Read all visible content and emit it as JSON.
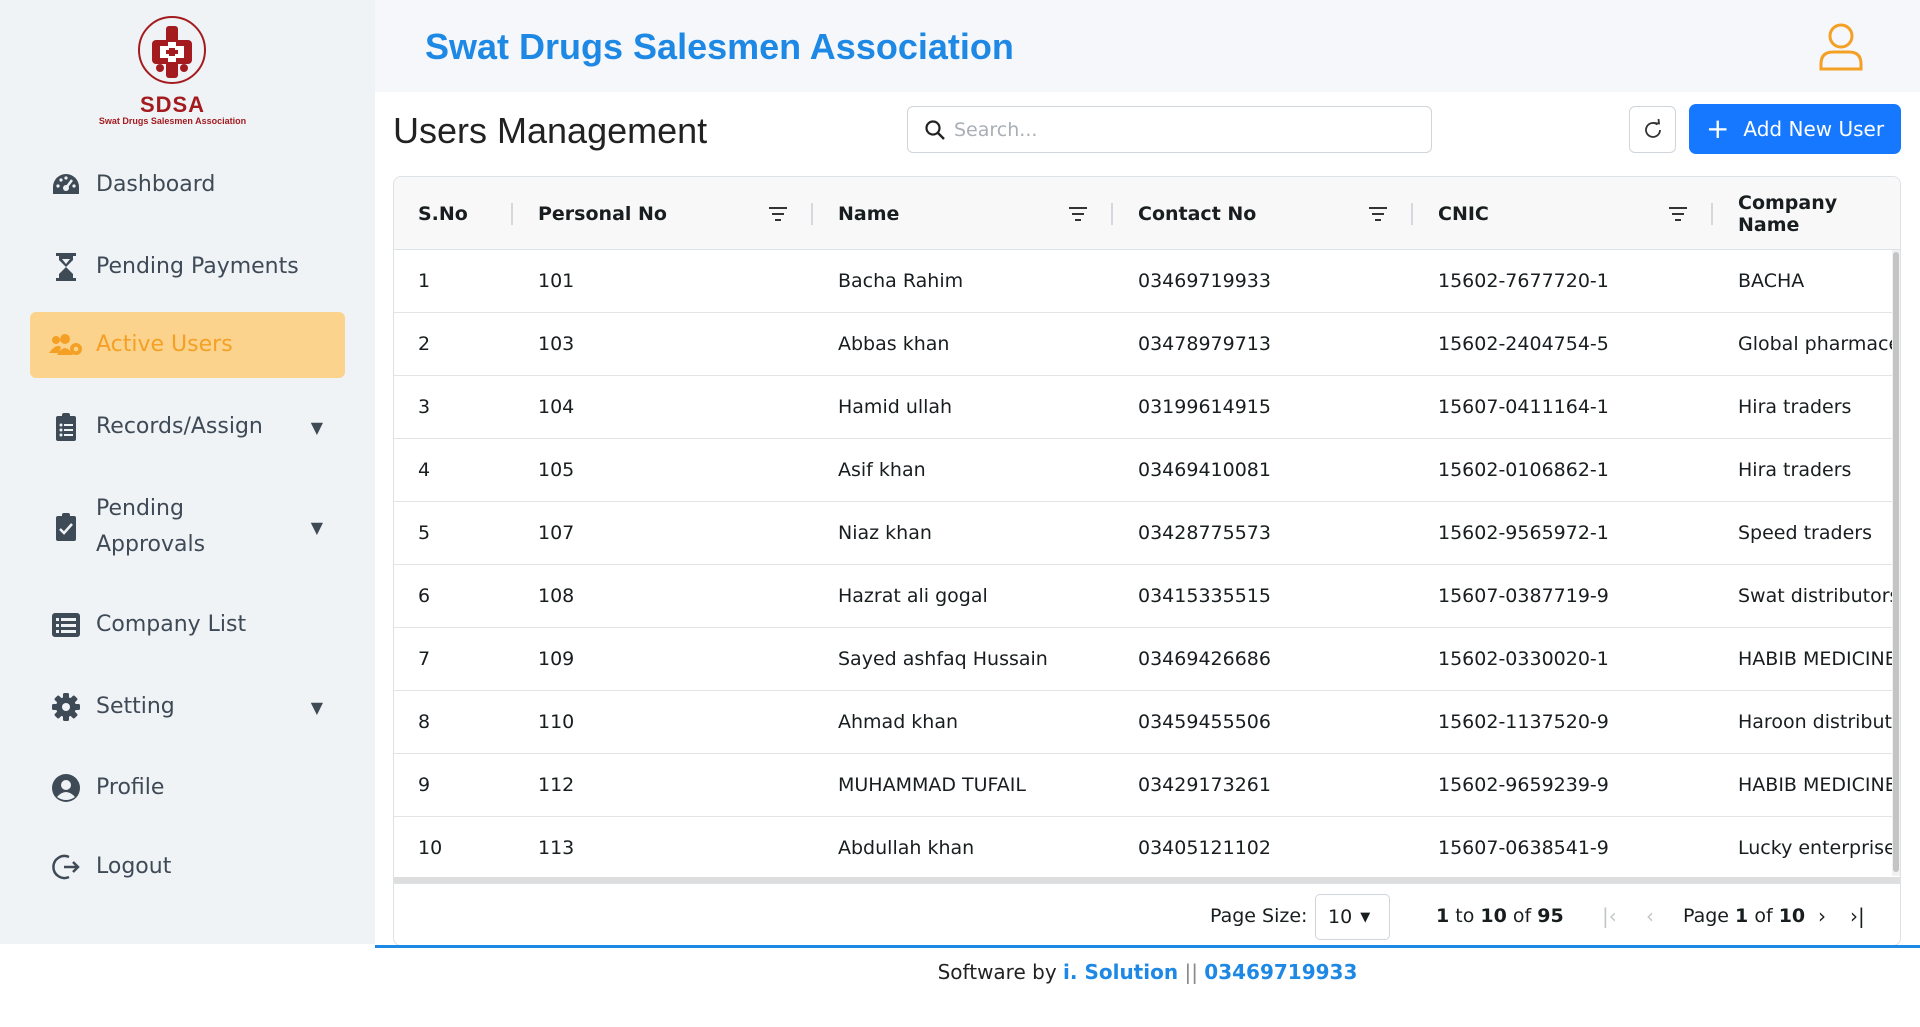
{
  "app": {
    "title": "Swat Drugs Salesmen Association",
    "logo_short": "SDSA",
    "logo_full": "Swat Drugs Salesmen Association"
  },
  "sidebar": {
    "items": [
      {
        "label": "Dashboard",
        "icon": "dashboard-gauge-icon"
      },
      {
        "label": "Pending Payments",
        "icon": "hourglass-icon"
      },
      {
        "label": "Active Users",
        "icon": "users-gear-icon",
        "active": true
      },
      {
        "label": "Records/Assign",
        "icon": "clipboard-list-icon",
        "caret": "▼"
      },
      {
        "label": "Pending",
        "label2": "Approvals",
        "icon": "clipboard-check-icon",
        "caret": "▼"
      },
      {
        "label": "Company List",
        "icon": "list-icon"
      },
      {
        "label": "Setting",
        "icon": "gear-icon",
        "caret": "▼"
      },
      {
        "label": "Profile",
        "icon": "user-circle-icon"
      },
      {
        "label": "Logout",
        "icon": "logout-icon"
      }
    ]
  },
  "main": {
    "title": "Users Management",
    "search_placeholder": "Search...",
    "add_button": "Add New User",
    "add_plus": "+"
  },
  "table": {
    "columns": [
      "S.No",
      "Personal No",
      "Name",
      "Contact No",
      "CNIC",
      "Company Name"
    ],
    "rows": [
      [
        "1",
        "101",
        "Bacha Rahim",
        "03469719933",
        "15602-7677720-1",
        "BACHA"
      ],
      [
        "2",
        "103",
        "Abbas khan",
        "03478979713",
        "15602-2404754-5",
        "Global pharmaceuticals"
      ],
      [
        "3",
        "104",
        "Hamid ullah",
        "03199614915",
        "15607-0411164-1",
        "Hira traders"
      ],
      [
        "4",
        "105",
        "Asif khan",
        "03469410081",
        "15602-0106862-1",
        "Hira traders"
      ],
      [
        "5",
        "107",
        "Niaz khan",
        "03428775573",
        "15602-9565972-1",
        "Speed traders"
      ],
      [
        "6",
        "108",
        "Hazrat ali gogal",
        "03415335515",
        "15607-0387719-9",
        "Swat distributors"
      ],
      [
        "7",
        "109",
        "Sayed ashfaq Hussain",
        "03469426686",
        "15602-0330020-1",
        "HABIB MEDICINE"
      ],
      [
        "8",
        "110",
        "Ahmad khan",
        "03459455506",
        "15602-1137520-9",
        "Haroon distributions"
      ],
      [
        "9",
        "112",
        "MUHAMMAD TUFAIL",
        "03429173261",
        "15602-9659239-9",
        "HABIB MEDICINE"
      ],
      [
        "10",
        "113",
        "Abdullah khan",
        "03405121102",
        "15607-0638541-9",
        "Lucky enterprise"
      ]
    ]
  },
  "pagination": {
    "page_size_label": "Page Size:",
    "page_size": "10",
    "range_from": "1",
    "range_to_word": "to",
    "range_to": "10",
    "of_word": "of",
    "total": "95",
    "page_word": "Page",
    "page": "1",
    "page_total": "10",
    "first": "|‹",
    "prev": "‹",
    "next": "›",
    "last": "›|"
  },
  "footer": {
    "prefix": "Software by",
    "brand": "i. Solution",
    "separator": "||",
    "phone": "03469719933"
  },
  "colors": {
    "accent": "#1e88e5",
    "active_bg": "#fbd38d",
    "active_text": "#f4a025",
    "button": "#1677ff",
    "logo_red": "#a31b1f"
  }
}
